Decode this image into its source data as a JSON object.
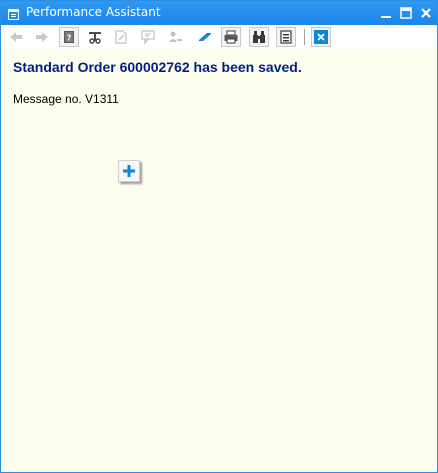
{
  "window": {
    "title": "Performance Assistant",
    "title_icon": "window-icon",
    "controls": [
      "minimize-icon",
      "maximize-icon",
      "close-icon"
    ]
  },
  "toolbar": {
    "buttons": [
      {
        "name": "back-icon",
        "enabled": false
      },
      {
        "name": "forward-icon",
        "enabled": false
      },
      {
        "name": "help-book-icon",
        "enabled": true
      },
      {
        "name": "technical-info-icon",
        "enabled": true
      },
      {
        "name": "edit-document-icon",
        "enabled": false
      },
      {
        "name": "glossary-icon",
        "enabled": false
      },
      {
        "name": "user-settings-icon",
        "enabled": false
      },
      {
        "name": "eraser-icon",
        "enabled": true
      },
      {
        "name": "print-icon",
        "enabled": true
      },
      {
        "name": "find-icon",
        "enabled": true
      },
      {
        "name": "document-list-icon",
        "enabled": true
      },
      {
        "name": "close-help-icon",
        "enabled": true
      }
    ]
  },
  "message": {
    "title": "Standard Order 600002762 has been saved.",
    "number_label": "Message no. V1311"
  },
  "colors": {
    "title_bar": "#1e90ff",
    "content_bg": "#fdfdee",
    "message_title": "#001f84",
    "accent": "#0a87d9"
  }
}
